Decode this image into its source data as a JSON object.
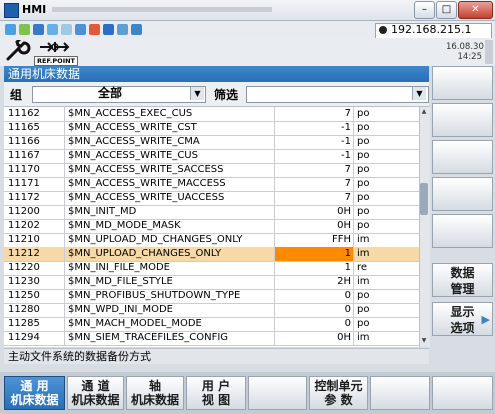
{
  "window": {
    "title": "HMI"
  },
  "tray": {
    "ip_address": "192.168.215.1"
  },
  "header": {
    "date": "16.08.30",
    "time": "14:25",
    "ref_point_label": "REF.POINT"
  },
  "screen": {
    "title": "通用机床数据"
  },
  "filter": {
    "group_label": "组",
    "group_value": "全部",
    "filter_label": "筛选",
    "filter_value": ""
  },
  "table": {
    "rows": [
      {
        "num": "11162",
        "name": "$MN_ACCESS_EXEC_CUS",
        "value": "7",
        "unit": "po"
      },
      {
        "num": "11165",
        "name": "$MN_ACCESS_WRITE_CST",
        "value": "-1",
        "unit": "po"
      },
      {
        "num": "11166",
        "name": "$MN_ACCESS_WRITE_CMA",
        "value": "-1",
        "unit": "po"
      },
      {
        "num": "11167",
        "name": "$MN_ACCESS_WRITE_CUS",
        "value": "-1",
        "unit": "po"
      },
      {
        "num": "11170",
        "name": "$MN_ACCESS_WRITE_SACCESS",
        "value": "7",
        "unit": "po"
      },
      {
        "num": "11171",
        "name": "$MN_ACCESS_WRITE_MACCESS",
        "value": "7",
        "unit": "po"
      },
      {
        "num": "11172",
        "name": "$MN_ACCESS_WRITE_UACCESS",
        "value": "7",
        "unit": "po"
      },
      {
        "num": "11200",
        "name": "$MN_INIT_MD",
        "value": "0H",
        "unit": "po"
      },
      {
        "num": "11202",
        "name": "$MN_MD_MODE_MASK",
        "value": "0H",
        "unit": "po"
      },
      {
        "num": "11210",
        "name": "$MN_UPLOAD_MD_CHANGES_ONLY",
        "value": "FFH",
        "unit": "im"
      },
      {
        "num": "11212",
        "name": "$MN_UPLOAD_CHANGES_ONLY",
        "value": "1",
        "unit": "im"
      },
      {
        "num": "11220",
        "name": "$MN_INI_FILE_MODE",
        "value": "1",
        "unit": "re"
      },
      {
        "num": "11230",
        "name": "$MN_MD_FILE_STYLE",
        "value": "2H",
        "unit": "im"
      },
      {
        "num": "11250",
        "name": "$MN_PROFIBUS_SHUTDOWN_TYPE",
        "value": "0",
        "unit": "po"
      },
      {
        "num": "11280",
        "name": "$MN_WPD_INI_MODE",
        "value": "0",
        "unit": "po"
      },
      {
        "num": "11285",
        "name": "$MN_MACH_MODEL_MODE",
        "value": "0",
        "unit": "po"
      },
      {
        "num": "11294",
        "name": "$MN_SIEM_TRACEFILES_CONFIG",
        "value": "0H",
        "unit": "im"
      }
    ],
    "selected_row": 10
  },
  "status": {
    "text": "主动文件系统的数据备份方式"
  },
  "vertical_softkeys": [
    {
      "line1": "",
      "line2": ""
    },
    {
      "line1": "",
      "line2": ""
    },
    {
      "line1": "",
      "line2": ""
    },
    {
      "line1": "",
      "line2": ""
    },
    {
      "line1": "",
      "line2": ""
    },
    {
      "line1": "数据",
      "line2": "管理"
    },
    {
      "line1": "显示",
      "line2": "选项"
    }
  ],
  "bottom_softkeys": [
    {
      "line1": "通  用",
      "line2": "机床数据",
      "active": true
    },
    {
      "line1": "通  道",
      "line2": "机床数据",
      "active": false
    },
    {
      "line1": "轴",
      "line2": "机床数据",
      "active": false
    },
    {
      "line1": "用 户",
      "line2": "视 图",
      "active": false
    },
    {
      "line1": "",
      "line2": "",
      "active": false
    },
    {
      "line1": "控制单元",
      "line2": "参  数",
      "active": false
    },
    {
      "line1": "",
      "line2": "",
      "active": false
    },
    {
      "line1": "",
      "line2": "",
      "active": false
    }
  ],
  "colors": {
    "accent": "#2a6fb5",
    "highlight_row": "#f7d9a8",
    "highlight_value": "#ff8a00"
  }
}
